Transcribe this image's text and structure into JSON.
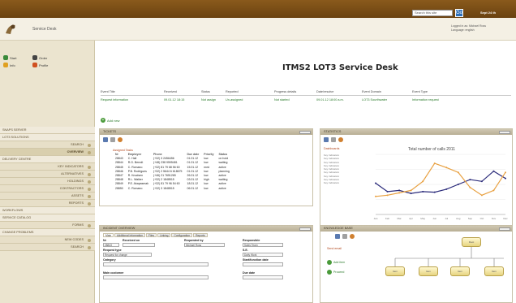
{
  "topbar": {
    "search_placeholder": "Search this site",
    "go_label": "Go",
    "date": "Sept 24 th"
  },
  "header": {
    "app_name": "Service Desk",
    "user_line1": "Logged in as: Michael Ross",
    "user_line2": "Language: english"
  },
  "sidebar": {
    "quick": [
      {
        "label": "Start",
        "icon": "start-icon",
        "color": "#3a8a3a"
      },
      {
        "label": "Order",
        "icon": "order-icon",
        "color": "#444"
      },
      {
        "label": "Info",
        "icon": "info-icon",
        "color": "#e0a020"
      },
      {
        "label": "Profile",
        "icon": "profile-icon",
        "color": "#d05020"
      }
    ],
    "items": [
      {
        "label": "SNAPS SERVER",
        "sub": false
      },
      {
        "label": "LOT3 SOLUTIONS",
        "sub": false
      },
      {
        "label": "SEARCH",
        "sub": true
      },
      {
        "label": "OVERVIEW",
        "sub": true,
        "active": true
      },
      {
        "label": "DELIVERY CENTRE",
        "sub": false
      },
      {
        "label": "KEY INDICATORS",
        "sub": true
      },
      {
        "label": "ALTERNATIVES",
        "sub": true
      },
      {
        "label": "HOLDINGS",
        "sub": true
      },
      {
        "label": "CONTRACTORS",
        "sub": true
      },
      {
        "label": "ASSETS",
        "sub": true
      },
      {
        "label": "REPORTS",
        "sub": true
      },
      {
        "label": "WORKFLOWS",
        "sub": false
      },
      {
        "label": "SERVICE CATALOG",
        "sub": false
      },
      {
        "label": "FORMS",
        "sub": true
      },
      {
        "label": "CHANGE PROBLEMS",
        "sub": false
      },
      {
        "label": "NEW CODES",
        "sub": true
      },
      {
        "label": "SEARCH",
        "sub": true
      }
    ]
  },
  "main": {
    "title": "ITMS2 LOT3 Service Desk",
    "event_headers": [
      "Event Title",
      "Received",
      "Status",
      "Reported",
      "Progress details",
      "Date/resolve",
      "Event Domain",
      "Event Type"
    ],
    "event_values": [
      "Request information",
      "09.01.12 18:15",
      "Not assign",
      "Un-assigned",
      "Not started",
      "09.01.12 18:00 a.m.",
      "LOT3 Sourthwater",
      "Information request"
    ],
    "add_new": "Add new"
  },
  "tickets": {
    "title": "TICKETS",
    "subtitle": "Assigned Tasks",
    "headers": [
      "Nr",
      "Employee",
      "Phone",
      "Due date",
      "Priority",
      "Status"
    ],
    "rows": [
      [
        "28843",
        "C. Hall",
        "(+32) 3 2456456",
        "01.01.12",
        "low",
        "on hold"
      ],
      [
        "28844",
        "R.G. Berndt",
        "(+48) 238 9595481",
        "01.01.12",
        "low",
        "waiting"
      ],
      [
        "28845",
        "C. Romano",
        "(+32) 81 79 68 56 60",
        "15.01.12",
        "med",
        "active"
      ],
      [
        "28846",
        "P.B. Rodrigues",
        "(+32) 2 5644 6 618675",
        "01.01.12",
        "low",
        "planning"
      ],
      [
        "28847",
        "R. Knudsen",
        "(+46) 21 7651265",
        "26.01.12",
        "low",
        "active"
      ],
      [
        "28848",
        "R.L. Walker",
        "(+32) 2 1848515",
        "03.01.12",
        "high",
        "waiting"
      ],
      [
        "28849",
        "P.E. Akapasmak",
        "(+32) 81 79 96 54 60",
        "18.01.12",
        "low",
        "active"
      ],
      [
        "28850",
        "C. Romano",
        "(+32) 3 1848515",
        "06.01.12",
        "low",
        "active"
      ]
    ]
  },
  "stats": {
    "title": "STATISTICS",
    "subtitle": "Dashboards",
    "legend": [
      "Key Indicators",
      "Key Indicators",
      "Key Indicators",
      "Key Indicators",
      "Key Indicators",
      "Key Indicators",
      "Key Indicators",
      "Key Indicators",
      "Key Indicators"
    ]
  },
  "chart_data": {
    "type": "line",
    "title": "Total number of calls 2011",
    "categories": [
      "Jan",
      "Feb",
      "Mar",
      "Apr",
      "May",
      "Jun",
      "Jul",
      "Aug",
      "Sep",
      "Oct",
      "Nov",
      "Dec"
    ],
    "series": [
      {
        "color": "#2a2a7a",
        "values": [
          52,
          38,
          40,
          35,
          38,
          37,
          42,
          50,
          58,
          55,
          72,
          60
        ]
      },
      {
        "color": "#e8a040",
        "values": [
          30,
          32,
          36,
          40,
          55,
          85,
          78,
          70,
          45,
          32,
          40,
          70
        ]
      }
    ],
    "ylim": [
      0,
      100
    ]
  },
  "incidents": {
    "title": "INCIDENT OVERVIEW",
    "tabs": [
      "Main",
      "Additional Information",
      "Files",
      "Linking",
      "Configuration",
      "Reports"
    ],
    "fields": [
      {
        "label": "Nr",
        "value": "28843"
      },
      {
        "label": "Received on",
        "value": ""
      },
      {
        "label": "Requested by",
        "value": "Michael Ross"
      },
      {
        "label": "Responsible",
        "value": "Sales Team"
      },
      {
        "label": "Request type",
        "value": "Request for change"
      },
      {
        "label": "S.E.",
        "value": "Daily Work"
      },
      {
        "label": "Category",
        "value": ""
      },
      {
        "label": "Start/function date",
        "value": ""
      },
      {
        "label": "Main customer",
        "value": ""
      },
      {
        "label": "Due date",
        "value": ""
      }
    ]
  },
  "knowledge": {
    "title": "KNOWLEDGE BASE",
    "subtitle": "Send email",
    "links": [
      "Add item",
      "Proceed"
    ],
    "nodes": [
      "Root",
      "Item",
      "Item",
      "Item",
      "Item"
    ]
  }
}
